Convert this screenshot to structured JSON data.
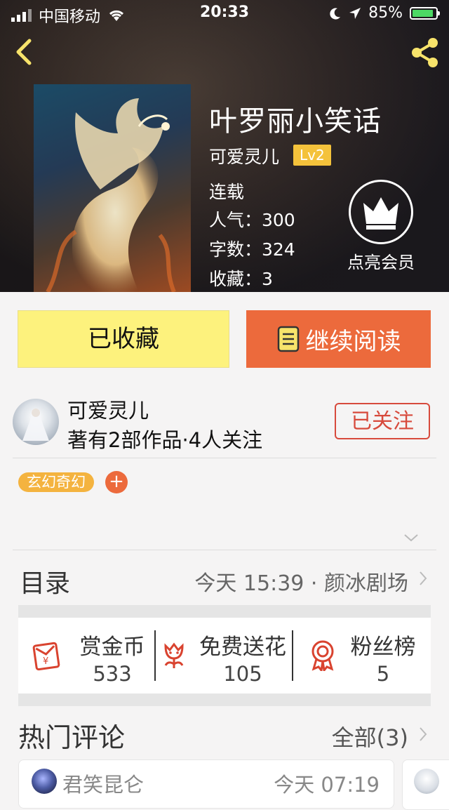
{
  "status_bar": {
    "carrier": "中国移动",
    "time": "20:33",
    "battery": "85%"
  },
  "book": {
    "title": "叶罗丽小笑话",
    "author": "可爱灵儿",
    "level": "Lv2",
    "status": "连载",
    "popularity": "人气：300",
    "word_count": "字数：324",
    "favorites": "收藏：3",
    "vip_label": "点亮会员"
  },
  "actions": {
    "favorited_label": "已收藏",
    "continue_label": "继续阅读"
  },
  "author_info": {
    "name": "可爱灵儿",
    "stats": "著有2部作品·4人关注",
    "follow_label": "已关注"
  },
  "tags": [
    "玄幻奇幻"
  ],
  "tag_add": "+",
  "toc": {
    "label": "目录",
    "update": "今天 15:39 · 颜冰剧场"
  },
  "rewards": [
    {
      "label": "赏金币",
      "value": "533",
      "icon": "red-envelope-icon"
    },
    {
      "label": "免费送花",
      "value": "105",
      "icon": "flower-icon"
    },
    {
      "label": "粉丝榜",
      "value": "5",
      "icon": "medal-icon"
    }
  ],
  "comments": {
    "title": "热门评论",
    "all_label": "全部(3)",
    "items": [
      {
        "user": "君笑昆仑",
        "time": "今天 07:19"
      }
    ]
  },
  "colors": {
    "favorite_button": "#fdf27d",
    "read_button": "#ec6a3c",
    "follow_border": "#d74a3c",
    "tag": "#f4b33f",
    "accent_yellow": "#f4c23b"
  }
}
